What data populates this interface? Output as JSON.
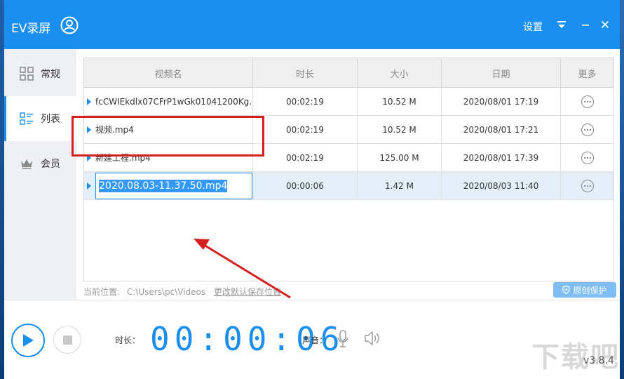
{
  "window": {
    "title": "EV录屏",
    "settings_label": "设置"
  },
  "sidebar": {
    "items": [
      {
        "label": "常规",
        "icon": "grid-icon"
      },
      {
        "label": "列表",
        "icon": "list-icon"
      },
      {
        "label": "会员",
        "icon": "crown-icon"
      }
    ],
    "active": "列表"
  },
  "table": {
    "headers": [
      "视频名",
      "时长",
      "大小",
      "日期",
      "更多"
    ],
    "rows": [
      {
        "name": "fcCWIEkdlx07CFrP1wGk01041200Kg...",
        "duration": "00:02:19",
        "size": "10.52 M",
        "date": "2020/08/01 17:19"
      },
      {
        "name": "视频.mp4",
        "duration": "00:02:19",
        "size": "10.52 M",
        "date": "2020/08/01 17:21"
      },
      {
        "name": "新建工程.mp4",
        "duration": "00:02:19",
        "size": "125.00 M",
        "date": "2020/08/01 17:39"
      },
      {
        "name": "2020.08.03-11.37.50.mp4",
        "duration": "00:00:06",
        "size": "1.42 M",
        "date": "2020/08/03 11:40"
      }
    ],
    "selected_row": 3,
    "rename_value": "2020.08.03-11.37.50.mp4"
  },
  "footer": {
    "path_label": "当前位置:",
    "path_value": "C:\\Users\\pc\\Videos",
    "change_link": "更改默认保存位置",
    "protect_button": "原创保护"
  },
  "player": {
    "duration_label": "时长：",
    "timer": "00:00:06",
    "sound_label": "声音：",
    "version": "v3.8.4",
    "watermark": "下载吧"
  },
  "colors": {
    "accent": "#1b8ff0",
    "highlight": "#d42020",
    "selected_row": "#e4eef8"
  }
}
